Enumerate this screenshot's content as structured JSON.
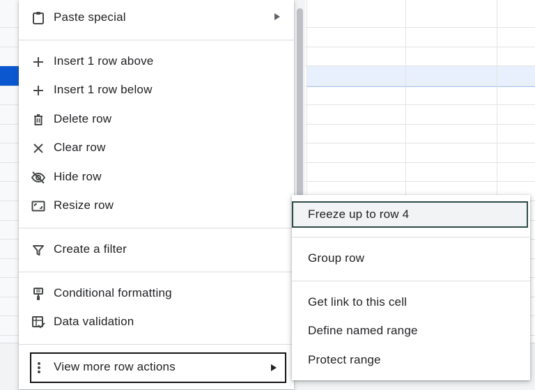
{
  "menu": {
    "items": [
      {
        "label": "Paste special",
        "icon": "clipboard-icon",
        "submenu": true
      },
      {
        "label": "Insert 1 row above",
        "icon": "plus-icon"
      },
      {
        "label": "Insert 1 row below",
        "icon": "plus-icon"
      },
      {
        "label": "Delete row",
        "icon": "trash-icon"
      },
      {
        "label": "Clear row",
        "icon": "close-icon"
      },
      {
        "label": "Hide row",
        "icon": "eye-off-icon"
      },
      {
        "label": "Resize row",
        "icon": "resize-icon"
      },
      {
        "label": "Create a filter",
        "icon": "filter-icon"
      },
      {
        "label": "Conditional formatting",
        "icon": "paint-roller-icon"
      },
      {
        "label": "Data validation",
        "icon": "data-validation-icon"
      },
      {
        "label": "View more row actions",
        "icon": "more-vert-icon",
        "submenu": true
      }
    ]
  },
  "submenu": {
    "items": [
      {
        "label": "Freeze up to row 4",
        "highlighted": true
      },
      {
        "label": "Group row"
      },
      {
        "label": "Get link to this cell"
      },
      {
        "label": "Define named range"
      },
      {
        "label": "Protect range"
      }
    ]
  },
  "colors": {
    "selected_row_fill": "#e8f0fe",
    "selected_row_header": "#0b57d0",
    "highlight_border": "#2e4a46"
  }
}
